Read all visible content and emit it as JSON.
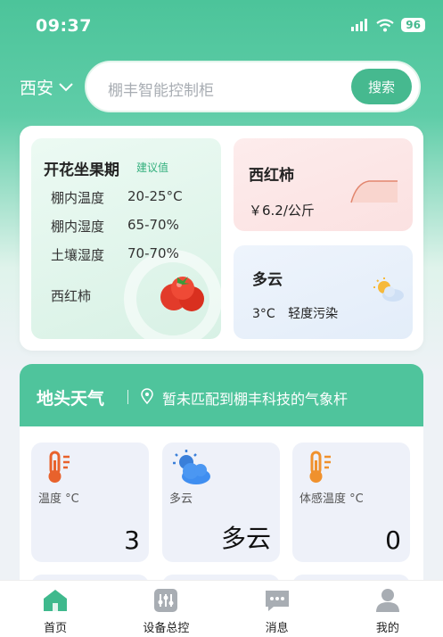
{
  "status_bar": {
    "time": "09:37",
    "battery": "96"
  },
  "header": {
    "city": "西安",
    "search_placeholder": "棚丰智能控制柜",
    "search_button": "搜索"
  },
  "crop_card": {
    "title": "开花坐果期",
    "tag": "建议值",
    "rows": [
      {
        "label": "棚内温度",
        "value": "20-25°C"
      },
      {
        "label": "棚内湿度",
        "value": "65-70%"
      },
      {
        "label": "土壤湿度",
        "value": "70-70%"
      }
    ],
    "crop_name": "西红柿"
  },
  "price_card": {
    "name": "西红柿",
    "price": "￥6.2/公斤"
  },
  "weather_card": {
    "condition": "多云",
    "temp": "3°C",
    "air": "轻度污染"
  },
  "field_weather": {
    "title": "地头天气",
    "message": "暂未匹配到棚丰科技的气象杆",
    "tiles": [
      {
        "label": "温度 °C",
        "value": "3",
        "icon": "thermometer-icon"
      },
      {
        "label": "多云",
        "value": "多云",
        "icon": "cloudy-icon"
      },
      {
        "label": "体感温度 °C",
        "value": "0",
        "icon": "thermometer-icon"
      }
    ]
  },
  "bottom_nav": {
    "items": [
      {
        "label": "首页",
        "icon": "home-icon"
      },
      {
        "label": "设备总控",
        "icon": "control-panel-icon"
      },
      {
        "label": "消息",
        "icon": "message-icon"
      },
      {
        "label": "我的",
        "icon": "profile-icon"
      }
    ]
  },
  "colors": {
    "accent": "#46b98f",
    "header_green": "#4fc49c"
  }
}
